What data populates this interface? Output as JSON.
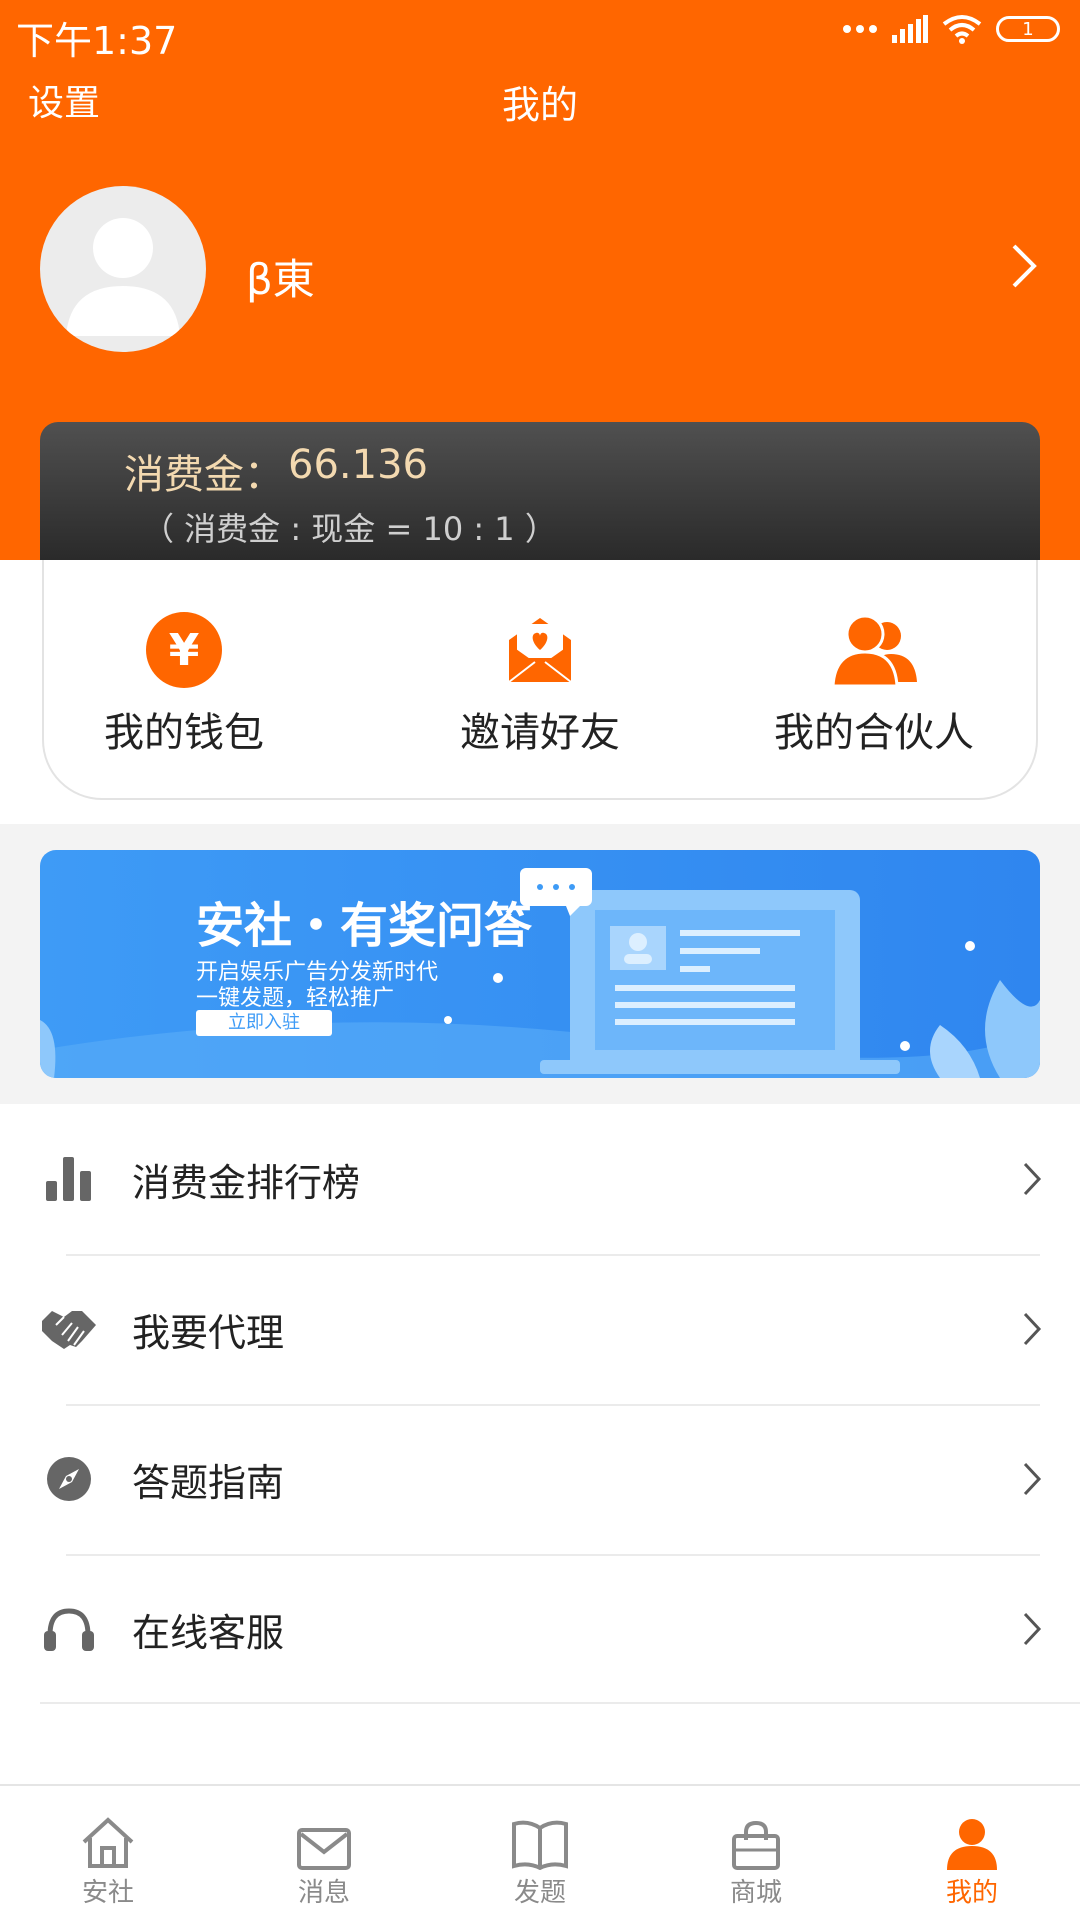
{
  "status_bar": {
    "time": "下午1:37",
    "battery": "1"
  },
  "header": {
    "settings": "设置",
    "title": "我的"
  },
  "profile": {
    "username": "β東"
  },
  "consumption": {
    "label": "消费金：",
    "value": "66.136",
    "note": "（ 消费金 : 现金 = 10 : 1 ）"
  },
  "quick_actions": [
    {
      "label": "我的钱包",
      "icon": "yen-icon"
    },
    {
      "label": "邀请好友",
      "icon": "invite-envelope-icon"
    },
    {
      "label": "我的合伙人",
      "icon": "partners-icon"
    }
  ],
  "banner": {
    "title": "安社・有奖问答",
    "line1": "开启娱乐广告分发新时代",
    "line2": "一键发题，轻松推广",
    "button": "立即入驻"
  },
  "menu": [
    {
      "label": "消费金排行榜",
      "icon": "bar-chart-icon"
    },
    {
      "label": "我要代理",
      "icon": "handshake-icon"
    },
    {
      "label": "答题指南",
      "icon": "compass-icon"
    },
    {
      "label": "在线客服",
      "icon": "headset-icon"
    }
  ],
  "bottom_nav": [
    {
      "label": "安社",
      "icon": "home-icon"
    },
    {
      "label": "消息",
      "icon": "mail-icon"
    },
    {
      "label": "发题",
      "icon": "book-icon"
    },
    {
      "label": "商城",
      "icon": "shopping-bag-icon"
    },
    {
      "label": "我的",
      "icon": "person-icon",
      "active": true
    }
  ],
  "colors": {
    "brand": "#ff6600",
    "banner": "#3e9bf6",
    "gold_text": "#f3d9b0"
  }
}
